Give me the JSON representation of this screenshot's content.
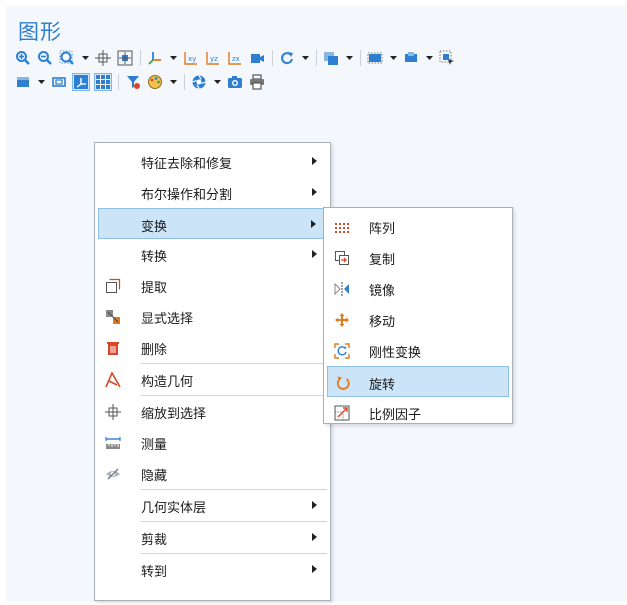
{
  "window": {
    "title": "图形"
  },
  "toolbar": {
    "row1": [
      "zoom-in-icon",
      "zoom-out-icon",
      "zoom-box-icon",
      "zoom-to-selection-icon",
      "zoom-extents-icon",
      "axis-orientation-icon",
      "view-xy-icon",
      "view-yz-icon",
      "view-zx-icon",
      "camera-view-icon",
      "rotate-icon",
      "render-mode-icon",
      "selection-mode-icon",
      "select-box-icon",
      "select-all-icon"
    ],
    "row2": [
      "scene-light-icon",
      "wireframe-icon",
      "show-axes-icon",
      "show-grid-icon",
      "filter-icon",
      "appearance-icon",
      "snapshot-icon",
      "camera-icon",
      "print-icon"
    ]
  },
  "context_menu": {
    "items": [
      {
        "label": "特征去除和修复",
        "icon": "",
        "submenu": true
      },
      {
        "label": "布尔操作和分割",
        "icon": "",
        "submenu": true
      },
      {
        "label": "变换",
        "icon": "",
        "submenu": true,
        "highlighted": true
      },
      {
        "label": "转换",
        "icon": "",
        "submenu": true
      },
      {
        "label": "提取",
        "icon": "extract-icon"
      },
      {
        "label": "显式选择",
        "icon": "explicit-selection-icon"
      },
      {
        "label": "删除",
        "icon": "delete-icon"
      },
      {
        "label": "构造几何",
        "icon": "build-geometry-icon"
      },
      {
        "label": "缩放到选择",
        "icon": "zoom-to-selection-icon"
      },
      {
        "label": "测量",
        "icon": "measure-icon"
      },
      {
        "label": "隐藏",
        "icon": "hide-icon"
      },
      {
        "label": "几何实体层",
        "icon": "",
        "submenu": true
      },
      {
        "label": "剪裁",
        "icon": "",
        "submenu": true
      },
      {
        "label": "转到",
        "icon": "",
        "submenu": true
      }
    ]
  },
  "transform_submenu": {
    "items": [
      {
        "label": "阵列",
        "icon": "array-icon"
      },
      {
        "label": "复制",
        "icon": "copy-icon"
      },
      {
        "label": "镜像",
        "icon": "mirror-icon"
      },
      {
        "label": "移动",
        "icon": "move-icon"
      },
      {
        "label": "刚性变换",
        "icon": "rigid-transform-icon"
      },
      {
        "label": "旋转",
        "icon": "rotate-icon",
        "highlighted": true
      },
      {
        "label": "比例因子",
        "icon": "scale-icon"
      }
    ]
  },
  "colors": {
    "accent": "#2f7fd1",
    "highlight": "#cce4f7",
    "icon_red": "#d9472b",
    "icon_blue": "#2f7fd1"
  }
}
